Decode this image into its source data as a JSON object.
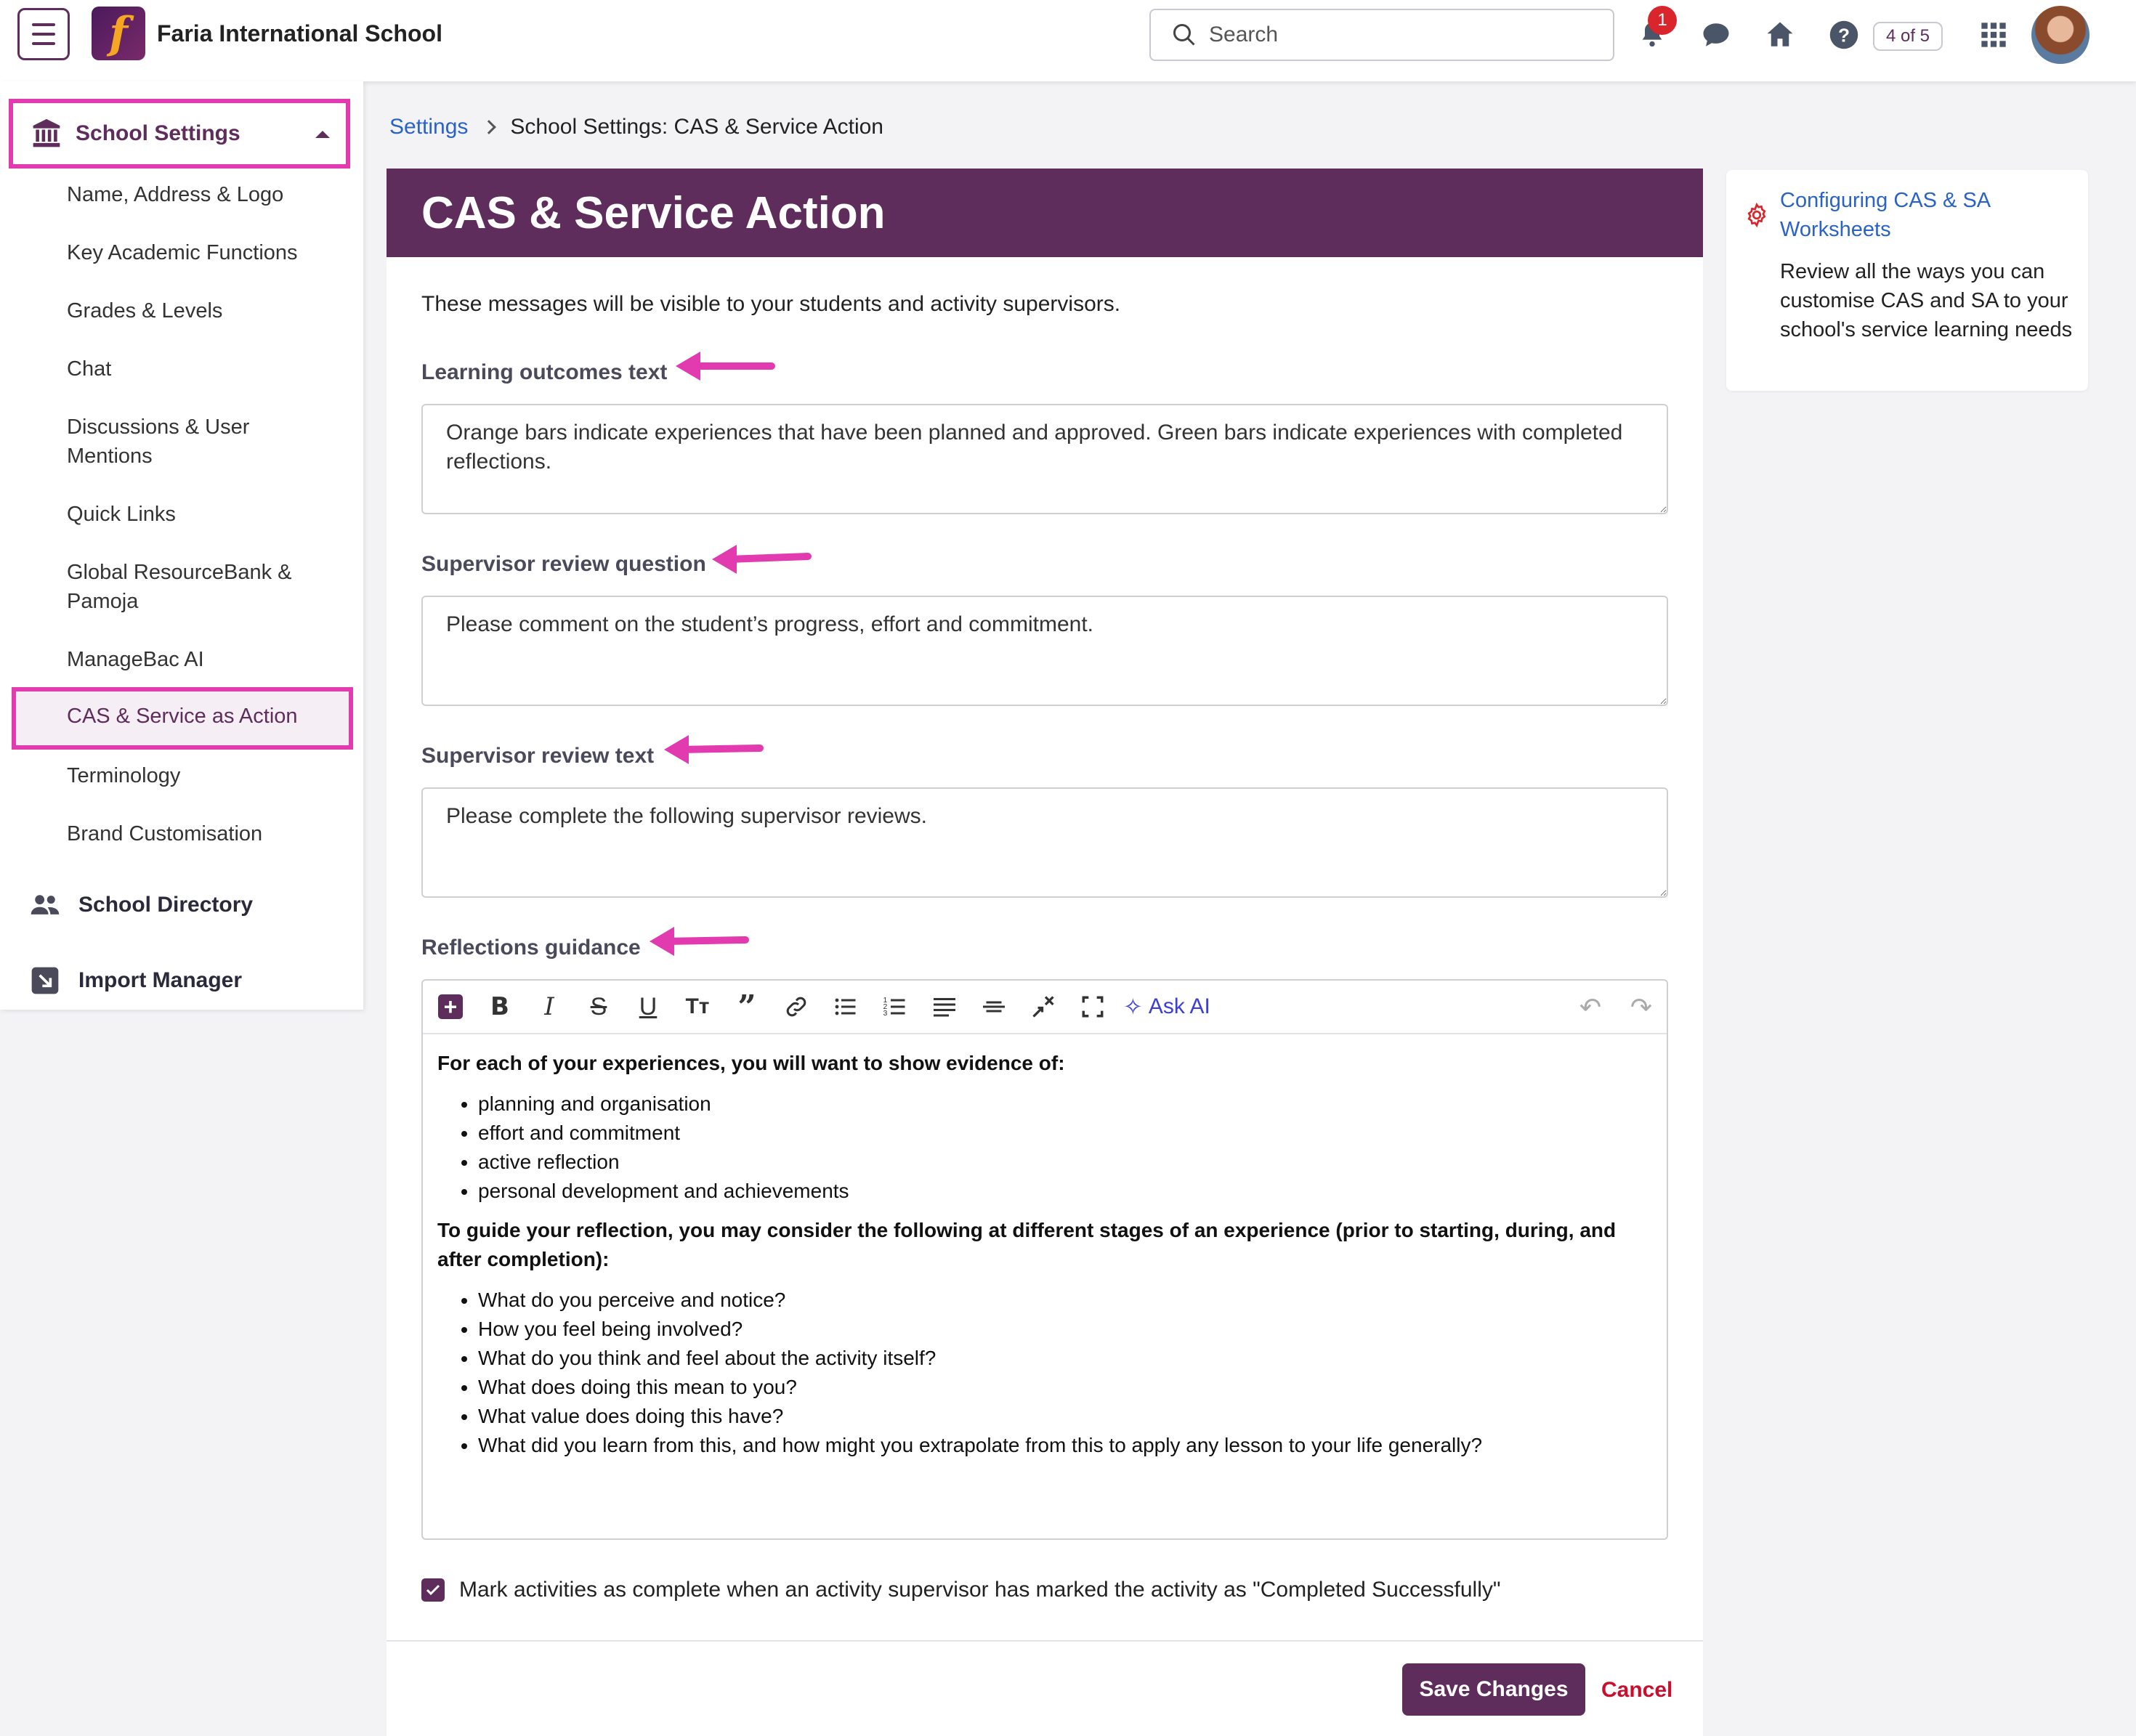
{
  "topbar": {
    "school_name": "Faria International School",
    "search_placeholder": "Search",
    "notification_count": "1",
    "progress_counter": "4 of 5",
    "icons": [
      "menu-icon",
      "bell-icon",
      "chat-icon",
      "home-icon",
      "help-icon",
      "apps-grid-icon"
    ]
  },
  "sidebar": {
    "group_label": "School Settings",
    "items": [
      "Name, Address & Logo",
      "Key Academic Functions",
      "Grades & Levels",
      "Chat",
      "Discussions & User Mentions",
      "Quick Links",
      "Global ResourceBank & Pamoja",
      "ManageBac AI",
      "CAS & Service as Action",
      "Terminology",
      "Brand Customisation"
    ],
    "sections": [
      "School Directory",
      "Import Manager"
    ]
  },
  "breadcrumb": {
    "parent": "Settings",
    "current": "School Settings: CAS & Service Action"
  },
  "main": {
    "title": "CAS & Service Action",
    "intro": "These messages will be visible to your students and activity supervisors.",
    "fields": [
      {
        "label": "Learning outcomes text",
        "value": "Orange bars indicate experiences that have been planned and approved. Green bars indicate experiences with completed reflections."
      },
      {
        "label": "Supervisor review question",
        "value": "Please comment on the student’s progress, effort and commitment."
      },
      {
        "label": "Supervisor review text",
        "value": "Please complete the following supervisor reviews."
      }
    ],
    "reflections": {
      "label": "Reflections guidance",
      "ask_ai": "Ask AI",
      "heading1": "For each of your experiences, you will want to show evidence of:",
      "list1": [
        "planning and organisation",
        "effort and commitment",
        "active reflection",
        "personal development and achievements"
      ],
      "heading2": "To guide your reflection, you may consider the following at different stages of an experience (prior to starting, during, and after completion):",
      "list2": [
        "What do you perceive and notice?",
        "How you feel being involved?",
        "What do you think and feel about the activity itself?",
        "What does doing this mean to you?",
        "What value does doing this have?",
        "What did you learn from this, and how might you extrapolate from this to apply any lesson to your life generally?"
      ]
    },
    "checkbox_label": "Mark activities as complete when an activity supervisor has marked the activity as \"Completed Successfully\"",
    "checkbox_checked": true,
    "save_label": "Save Changes",
    "cancel_label": "Cancel"
  },
  "help": {
    "title": "Configuring CAS & SA Worksheets",
    "description": "Review all the ways you can customise CAS and SA to your school's service learning needs"
  },
  "colors": {
    "brand": "#5e2d5c",
    "highlight": "#e23bb0",
    "link": "#2a63c7",
    "cancel": "#c8102e",
    "badge": "#d9262c"
  }
}
